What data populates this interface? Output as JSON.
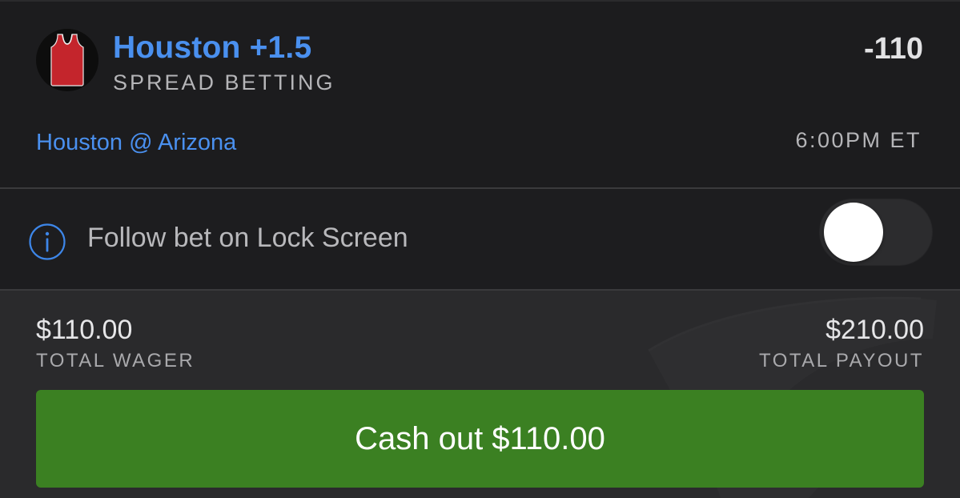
{
  "bet": {
    "title": "Houston +1.5",
    "type": "SPREAD BETTING",
    "odds": "-110",
    "matchup": "Houston @ Arizona",
    "time": "6:00PM ET",
    "team_icon": "basketball-jersey-icon",
    "jersey_color": "#c4252c"
  },
  "follow": {
    "label": "Follow bet on Lock Screen",
    "icon": "info-icon",
    "toggle_on": false
  },
  "summary": {
    "wager_amount": "$110.00",
    "wager_label": "TOTAL WAGER",
    "payout_amount": "$210.00",
    "payout_label": "TOTAL PAYOUT"
  },
  "cashout": {
    "label": "Cash out $110.00"
  },
  "colors": {
    "accent_blue": "#4a90ef",
    "cashout_green": "#3b8022",
    "background": "#1d1d1f"
  }
}
